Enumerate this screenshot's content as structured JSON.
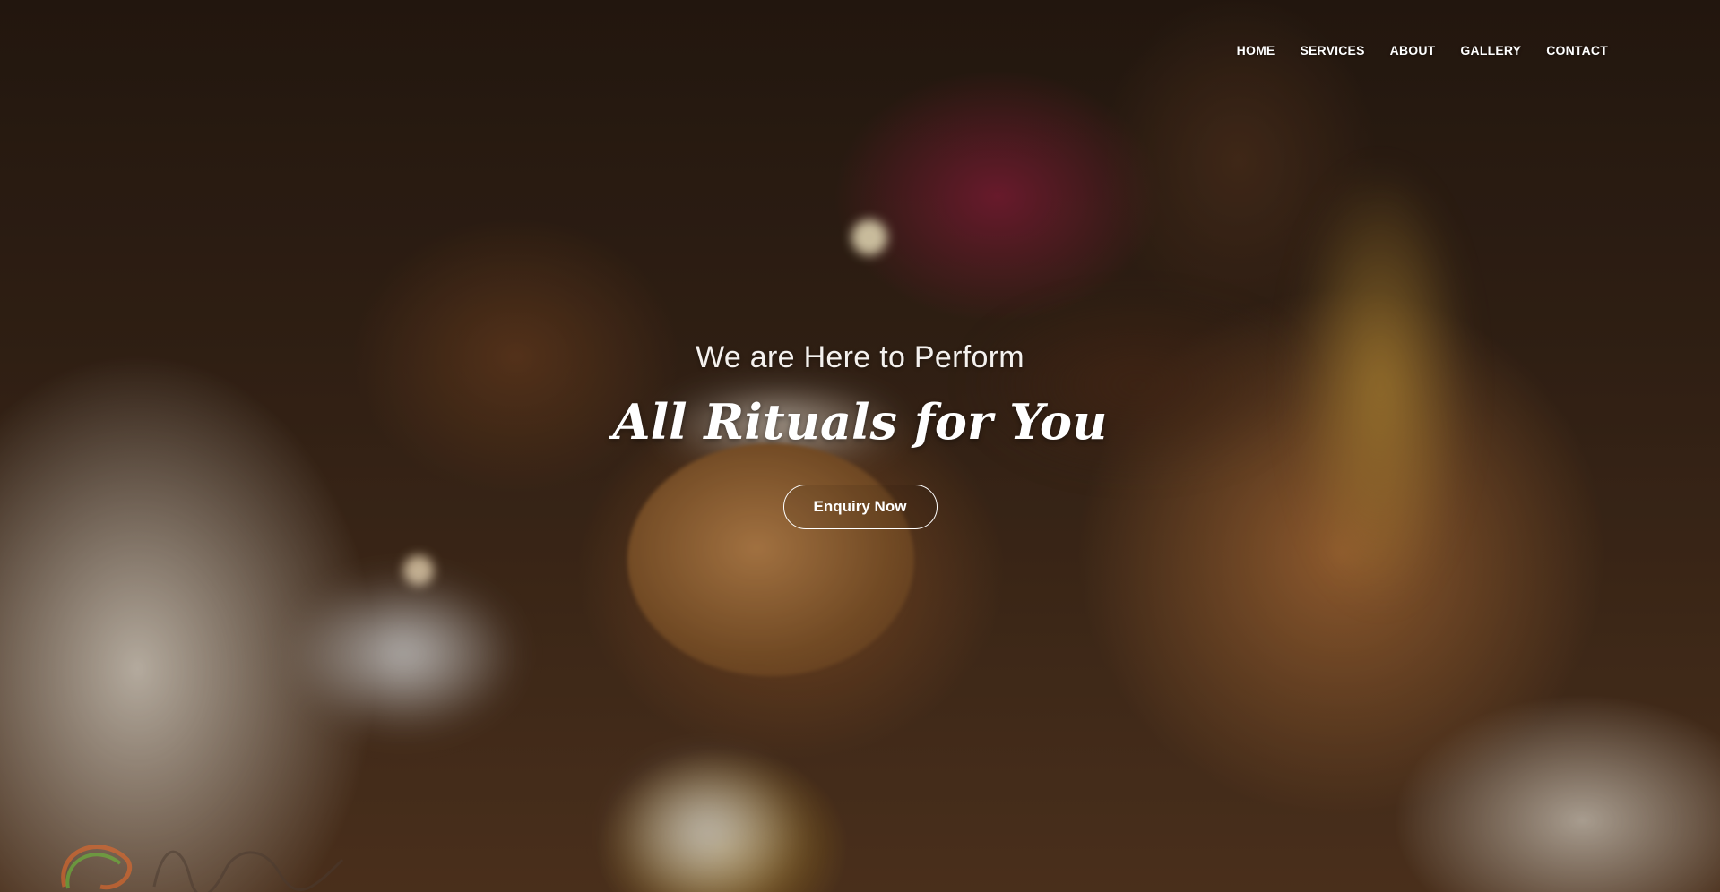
{
  "nav": {
    "items": [
      {
        "label": "HOME"
      },
      {
        "label": "SERVICES"
      },
      {
        "label": "ABOUT"
      },
      {
        "label": "GALLERY"
      },
      {
        "label": "CONTACT"
      }
    ]
  },
  "hero": {
    "tagline": "We are Here to Perform",
    "headline": "All Rituals for You",
    "cta_label": "Enquiry Now",
    "background_image": "ritual-ceremony-coconut-photo"
  },
  "watermark": {
    "text": "…web tatafolio"
  },
  "colors": {
    "text": "#ffffff",
    "button_border": "#ffffff"
  }
}
